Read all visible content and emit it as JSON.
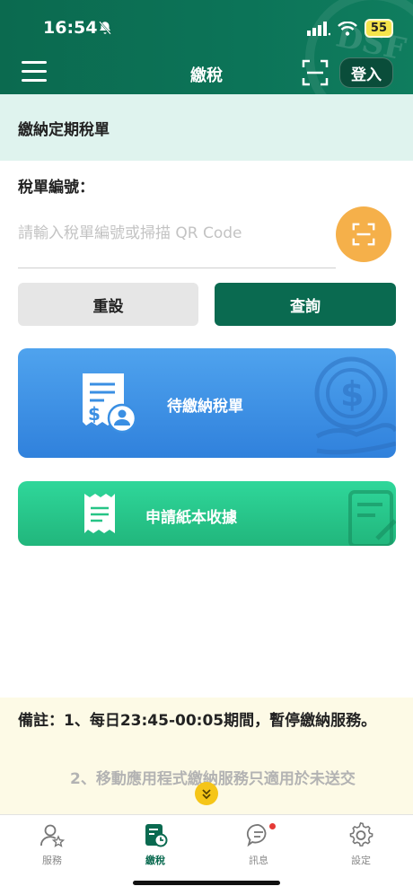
{
  "status": {
    "time": "16:54",
    "battery": "55"
  },
  "header": {
    "title": "繳稅",
    "login_label": "登入"
  },
  "section": {
    "title": "繳納定期稅單"
  },
  "form": {
    "field_label": "稅單編號：",
    "input_value": "",
    "input_placeholder": "請輸入稅單編號或掃描 QR Code",
    "reset_label": "重設",
    "query_label": "查詢"
  },
  "cards": {
    "pending_label": "待繳納稅單",
    "receipt_label": "申請紙本收據"
  },
  "notice": {
    "label": "備註：",
    "item1": "1、每日23:45-00:05期間，暫停繳納服務。",
    "item2": "2、移動應用程式繳納服務只適用於未送交"
  },
  "tabs": [
    {
      "label": "服務",
      "icon": "user-star-icon",
      "active": false
    },
    {
      "label": "繳稅",
      "icon": "tax-bill-icon",
      "active": true
    },
    {
      "label": "訊息",
      "icon": "chat-icon",
      "active": false,
      "badge": true
    },
    {
      "label": "設定",
      "icon": "gear-icon",
      "active": false
    }
  ],
  "colors": {
    "primary": "#0a6a50",
    "section_bg": "#dff3ee",
    "scan_button": "#f5b04a",
    "pending_card": "#3a8fe3",
    "receipt_card": "#26c486",
    "notice_bg": "#fdfae6",
    "badge": "#e53935"
  }
}
